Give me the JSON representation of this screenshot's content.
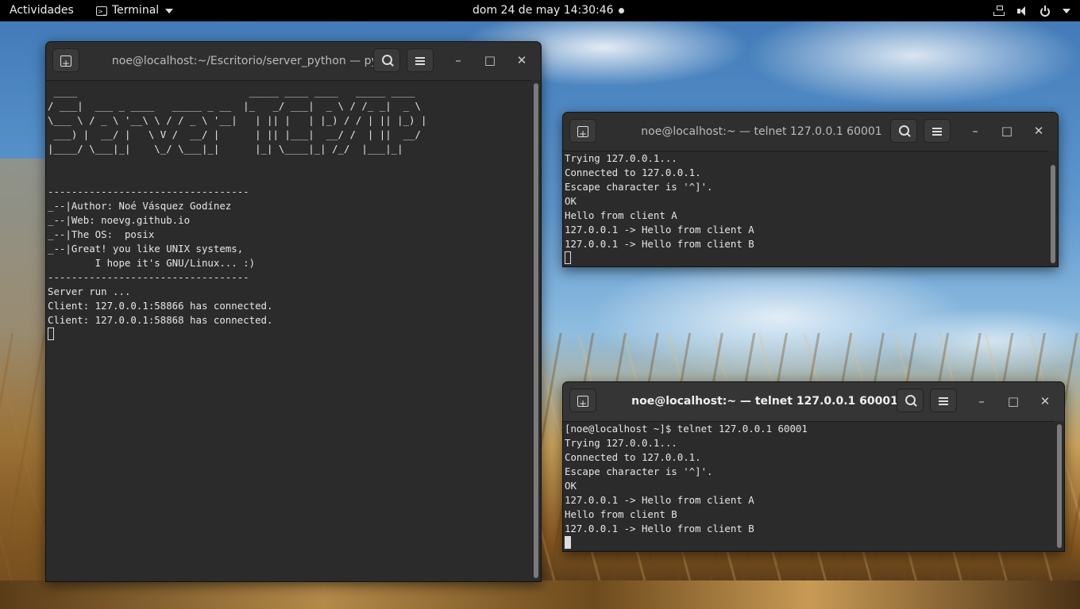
{
  "topbar": {
    "activities": "Actividades",
    "app_menu": "Terminal",
    "clock": "dom 24 de may  14:30:46",
    "icons": [
      "network-icon",
      "volume-icon",
      "power-icon"
    ]
  },
  "windows": {
    "server": {
      "title": "noe@localhost:~/Escritorio/server_python — py...",
      "lines": [
        " ____                             _____ ____ ____   _____ ____",
        "/ ___|  ___ _ ____   _____ _ __  |_   _/ ___|  _ \\ / /_ _|  _ \\",
        "\\___ \\ / _ \\ '__\\ \\ / / _ \\ '__|   | || |   | |_) / / | || |_) |",
        " ___) |  __/ |   \\ V /  __/ |      | || |___|  __/ /  | ||  __/",
        "|____/ \\___|_|    \\_/ \\___|_|      |_| \\____|_| /_/  |___|_|",
        "",
        "",
        "----------------------------------",
        "_--|Author: Noé Vásquez Godínez",
        "_--|Web: noevg.github.io",
        "_--|The OS:  posix",
        "_--|Great! you like UNIX systems,",
        "        I hope it's GNU/Linux... :)",
        "----------------------------------",
        "Server run ...",
        "Client: 127.0.0.1:58866 has connected.",
        "Client: 127.0.0.1:58868 has connected."
      ]
    },
    "client_a": {
      "title": "noe@localhost:~ — telnet 127.0.0.1 60001",
      "lines": [
        "Trying 127.0.0.1...",
        "Connected to 127.0.0.1.",
        "Escape character is '^]'.",
        "OK",
        "Hello from client A",
        "127.0.0.1 -> Hello from client A",
        "127.0.0.1 -> Hello from client B"
      ]
    },
    "client_b": {
      "title": "noe@localhost:~ — telnet 127.0.0.1 60001",
      "lines": [
        "[noe@localhost ~]$ telnet 127.0.0.1 60001",
        "Trying 127.0.0.1...",
        "Connected to 127.0.0.1.",
        "Escape character is '^]'.",
        "OK",
        "127.0.0.1 -> Hello from client A",
        "Hello from client B",
        "127.0.0.1 -> Hello from client B"
      ]
    }
  },
  "window_controls": {
    "minimize": "–",
    "maximize": "□",
    "close": "✕"
  }
}
